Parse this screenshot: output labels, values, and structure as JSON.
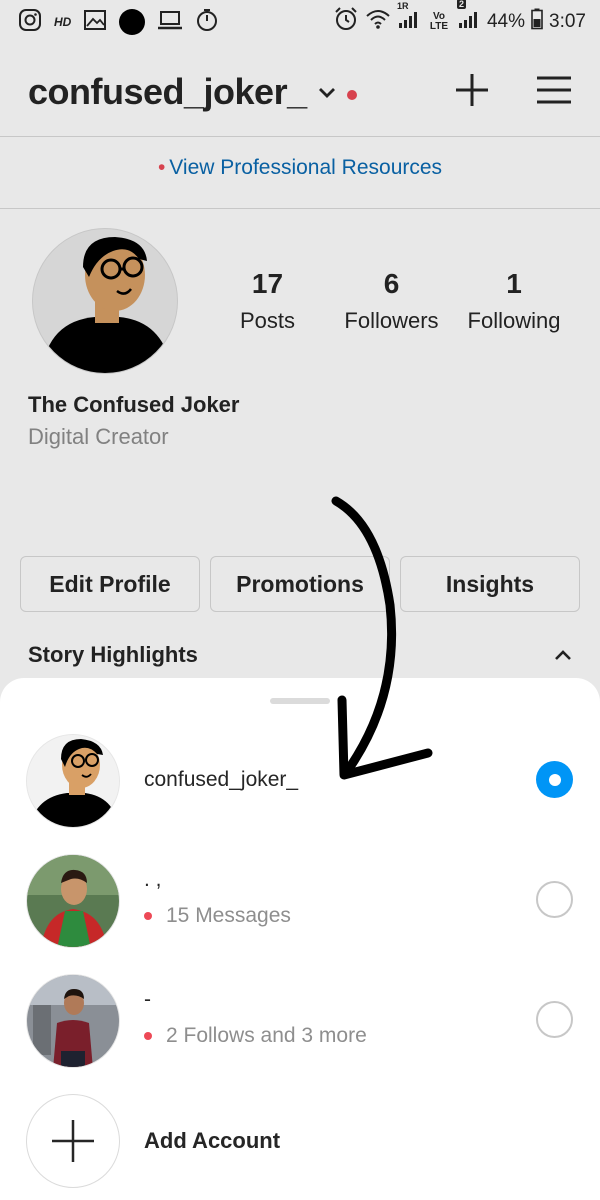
{
  "status_bar": {
    "left_icons": [
      "instagram-icon",
      "hd-icon",
      "gallery-icon",
      "record-dot-icon",
      "laptop-icon",
      "timer-icon"
    ],
    "hd_label": "HD",
    "right_icons": [
      "alarm-icon",
      "wifi-icon",
      "signal-icon",
      "volte-icon",
      "signal-icon"
    ],
    "sim_labels": [
      "1R",
      "2"
    ],
    "volte_label": "Vo LTE",
    "battery": "44%",
    "time": "3:07"
  },
  "header": {
    "username": "confused_joker_",
    "icons": [
      "chevron-down-icon",
      "notification-dot",
      "plus-icon",
      "menu-icon"
    ]
  },
  "pro_link": {
    "bullet": "•",
    "label": "View Professional Resources"
  },
  "profile": {
    "stats": [
      {
        "value": "17",
        "label": "Posts"
      },
      {
        "value": "6",
        "label": "Followers"
      },
      {
        "value": "1",
        "label": "Following"
      }
    ],
    "full_name": "The Confused Joker",
    "category": "Digital Creator"
  },
  "buttons": {
    "edit_profile": "Edit Profile",
    "promotions": "Promotions",
    "insights": "Insights"
  },
  "story_highlights": {
    "label": "Story Highlights"
  },
  "account_sheet": {
    "accounts": [
      {
        "name": "confused_joker_",
        "subtitle": "",
        "selected": true
      },
      {
        "name": ". ,",
        "subtitle": "15 Messages",
        "selected": false
      },
      {
        "name": "-",
        "subtitle": "2 Follows and 3 more",
        "selected": false
      }
    ],
    "add_account": "Add Account"
  },
  "colors": {
    "accent": "#0095f6",
    "link": "#0a6ab3",
    "notification": "#ed4956",
    "text": "#262626",
    "secondary": "#8e8e8e",
    "border": "#dbdbdb"
  }
}
